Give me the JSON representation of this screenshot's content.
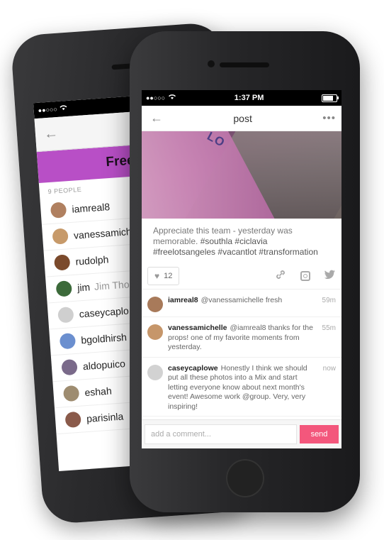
{
  "back_screen": {
    "banner_title": "Free L",
    "people_count": "9 PEOPLE",
    "people": [
      {
        "name": "iamreal8",
        "sub": "",
        "color": "#b08060"
      },
      {
        "name": "vanessamiche",
        "sub": "",
        "color": "#c79a6a"
      },
      {
        "name": "rudolph",
        "sub": "",
        "color": "#7b4a2c"
      },
      {
        "name": "jim",
        "sub": "Jim Tho",
        "color": "#3c6a3a"
      },
      {
        "name": "caseycaplo",
        "sub": "",
        "color": "#cfcfcf"
      },
      {
        "name": "bgoldhirsh",
        "sub": "",
        "color": "#6b8fcf"
      },
      {
        "name": "aldopuico",
        "sub": "",
        "color": "#7a6a8a"
      },
      {
        "name": "eshah",
        "sub": "",
        "color": "#9e8c70"
      },
      {
        "name": "parisinla",
        "sub": "",
        "color": "#8a5a4a"
      }
    ]
  },
  "status": {
    "time": "1:37 PM",
    "signal": "●●○○○",
    "back_signal": "●●○○○"
  },
  "nav": {
    "back_icon": "←",
    "title": "post",
    "more_icon": "•••"
  },
  "photo": {
    "banner_word": "LO"
  },
  "post": {
    "caption": "Appreciate this team - yesterday was memorable.",
    "tags": "#southla #ciclavia #freelotsangeles #vacantlot #transformation",
    "like_count": "12"
  },
  "comments": [
    {
      "user": "iamreal8",
      "text": "@vanessamichelle fresh",
      "time": "59m",
      "color": "#a87a5a"
    },
    {
      "user": "vanessamichelle",
      "text": "@iamreal8 thanks for the props! one of my favorite moments from yesterday.",
      "time": "55m",
      "color": "#c6966a"
    },
    {
      "user": "caseycaplowe",
      "text": "Honestly I think we should put all these photos into a Mix and start letting everyone know about next month's event! Awesome work @group. Very, very inspiring!",
      "time": "now",
      "color": "#d2d2d2"
    }
  ],
  "composer": {
    "placeholder": "add a comment...",
    "send_label": "send"
  }
}
